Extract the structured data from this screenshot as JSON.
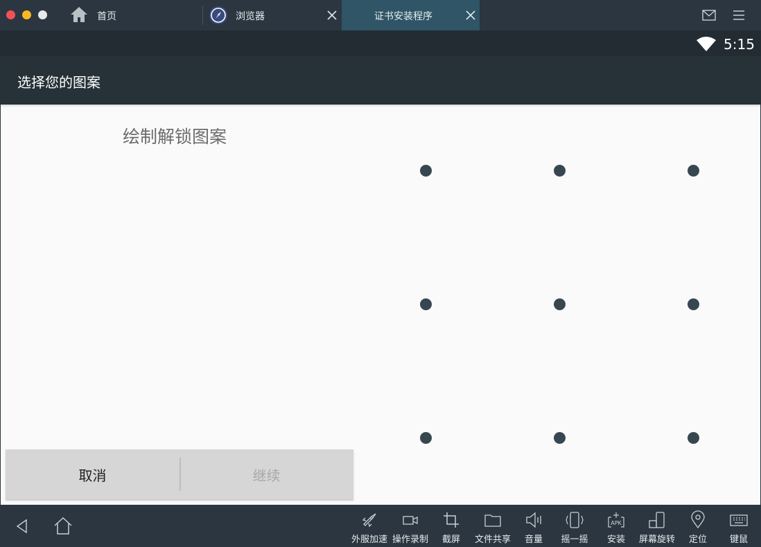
{
  "window": {
    "tabs": [
      {
        "label": "首页",
        "icon": "home-icon"
      },
      {
        "label": "浏览器",
        "icon": "browser-icon"
      },
      {
        "label": "证书安装程序",
        "active": true
      }
    ]
  },
  "status_bar": {
    "time": "5:15",
    "icon": "wifi-icon"
  },
  "app_bar": {
    "title": "选择您的图案"
  },
  "content": {
    "hint": "绘制解锁图案",
    "pattern_dots": 9,
    "cancel_label": "取消",
    "continue_label": "继续"
  },
  "toolbar": {
    "items": [
      {
        "label": "外服加速",
        "icon": "rocket-icon"
      },
      {
        "label": "操作录制",
        "icon": "video-camera-icon"
      },
      {
        "label": "截屏",
        "icon": "crop-icon"
      },
      {
        "label": "文件共享",
        "icon": "folder-icon"
      },
      {
        "label": "音量",
        "icon": "speaker-icon"
      },
      {
        "label": "摇一摇",
        "icon": "shake-phone-icon"
      },
      {
        "label": "安装",
        "icon": "apk-install-icon"
      },
      {
        "label": "屏幕旋转",
        "icon": "rotate-screen-icon"
      },
      {
        "label": "定位",
        "icon": "location-pin-icon"
      },
      {
        "label": "键鼠",
        "icon": "keyboard-icon"
      }
    ]
  },
  "colors": {
    "chrome": "#2b3640",
    "active_tab": "#2f5566",
    "app_bar": "#263238",
    "content_bg": "#fafafa",
    "dot": "#37474f"
  }
}
